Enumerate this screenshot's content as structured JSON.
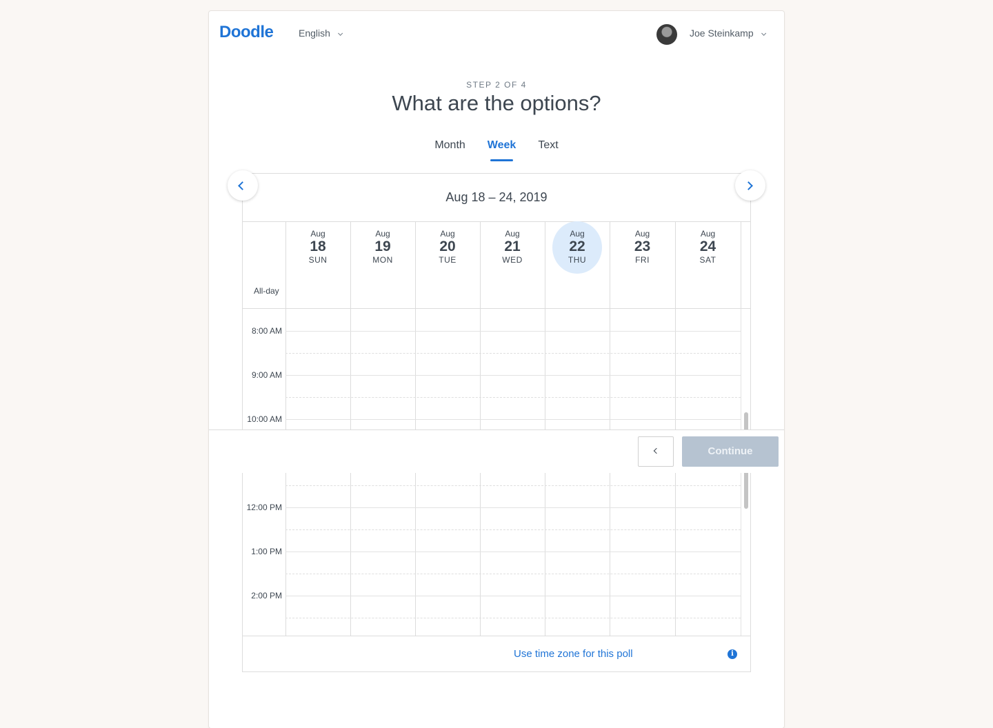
{
  "header": {
    "logo": "Doodle",
    "language": "English",
    "user_name": "Joe Steinkamp"
  },
  "step": {
    "label": "STEP 2 OF 4",
    "title": "What are the options?"
  },
  "tabs": [
    {
      "label": "Month",
      "active": false
    },
    {
      "label": "Week",
      "active": true
    },
    {
      "label": "Text",
      "active": false
    }
  ],
  "calendar": {
    "range": "Aug 18 – 24, 2019",
    "allday_label": "All-day",
    "days": [
      {
        "month": "Aug",
        "num": "18",
        "dow": "SUN",
        "today": false
      },
      {
        "month": "Aug",
        "num": "19",
        "dow": "MON",
        "today": false
      },
      {
        "month": "Aug",
        "num": "20",
        "dow": "TUE",
        "today": false
      },
      {
        "month": "Aug",
        "num": "21",
        "dow": "WED",
        "today": false
      },
      {
        "month": "Aug",
        "num": "22",
        "dow": "THU",
        "today": true
      },
      {
        "month": "Aug",
        "num": "23",
        "dow": "FRI",
        "today": false
      },
      {
        "month": "Aug",
        "num": "24",
        "dow": "SAT",
        "today": false
      }
    ],
    "times": [
      "8:00 AM",
      "9:00 AM",
      "10:00 AM",
      "12:00 PM",
      "1:00 PM",
      "2:00 PM"
    ],
    "timezone_link": "Use time zone for this poll"
  },
  "footer": {
    "continue_label": "Continue"
  },
  "colors": {
    "accent": "#1f74d6",
    "today_bg": "#dcebfb",
    "continue_disabled": "#b6c3d1"
  }
}
